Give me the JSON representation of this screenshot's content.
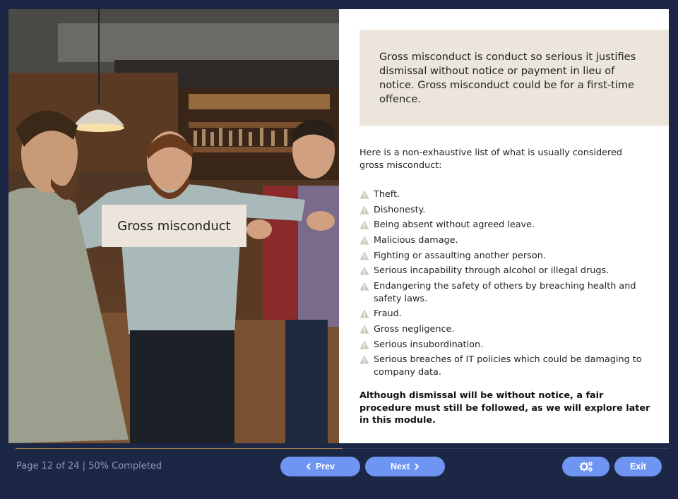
{
  "photo": {
    "caption": "Gross misconduct"
  },
  "content": {
    "callout": "Gross misconduct is conduct so serious it justifies dismissal without notice or payment in lieu of notice. Gross misconduct could be for a first-time offence.",
    "intro": "Here is a non-exhaustive list of what is usually considered gross misconduct:",
    "items": [
      "Theft.",
      "Dishonesty.",
      "Being absent without agreed leave.",
      "Malicious damage.",
      "Fighting or assaulting another person.",
      "Serious incapability through alcohol or illegal drugs.",
      "Endangering the safety of others by breaching health and safety laws.",
      "Fraud.",
      "Gross negligence.",
      "Serious insubordination.",
      "Serious breaches of IT policies which could be damaging to company data."
    ],
    "closing": "Although dismissal will be without notice, a fair procedure must still be followed, as we will explore later in this module."
  },
  "footer": {
    "page_status": "Page 12 of 24 | 50% Completed",
    "progress_fraction": 0.5,
    "prev_label": "Prev",
    "next_label": "Next",
    "exit_label": "Exit",
    "settings_icon": "gears-icon"
  },
  "colors": {
    "background": "#1c2746",
    "button": "#6f95f2",
    "callout_bg": "#ece5dc",
    "progress": "#a7844a",
    "warning_icon": "#cfc8bd"
  }
}
